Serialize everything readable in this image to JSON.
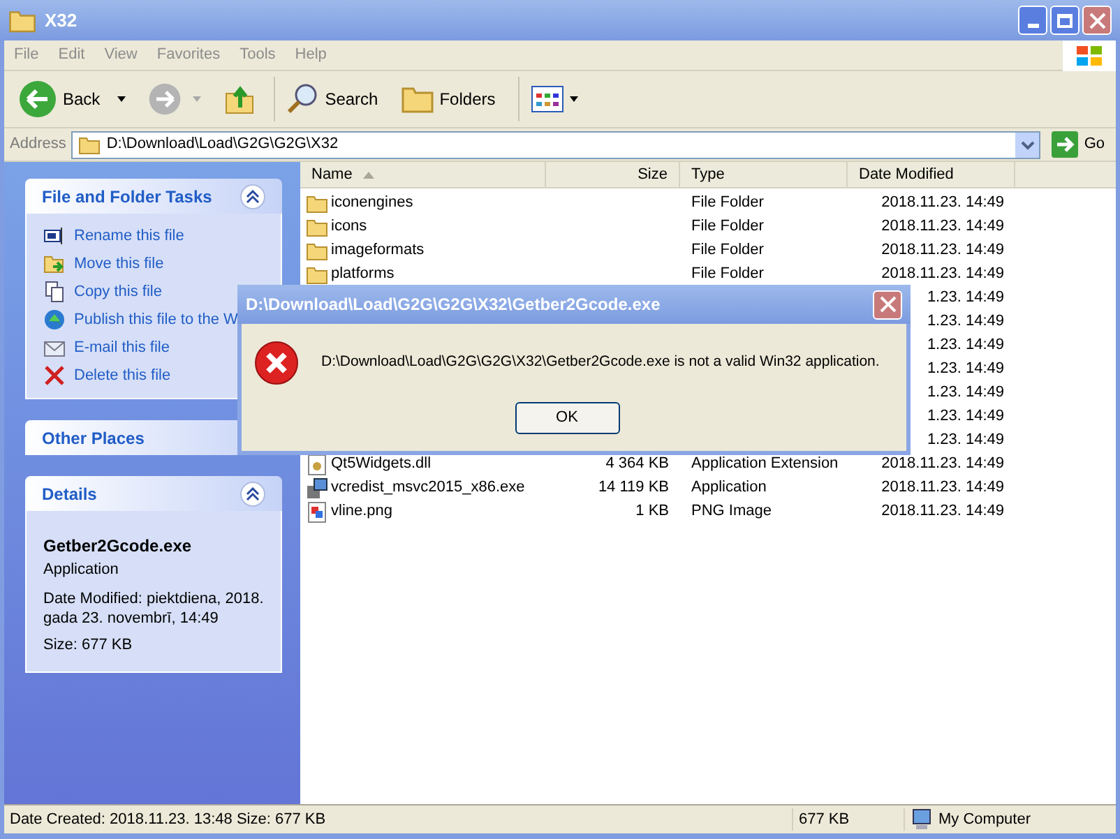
{
  "window": {
    "title": "X32"
  },
  "menu": [
    "File",
    "Edit",
    "View",
    "Favorites",
    "Tools",
    "Help"
  ],
  "toolbar": [
    {
      "kind": "back",
      "label": "Back"
    },
    {
      "kind": "forward"
    },
    {
      "kind": "up"
    },
    {
      "kind": "search",
      "label": "Search"
    },
    {
      "kind": "folders",
      "label": "Folders"
    },
    {
      "kind": "views"
    }
  ],
  "address": {
    "label": "Address",
    "value": "D:\\Download\\Load\\G2G\\G2G\\X32",
    "go": "Go"
  },
  "sidebar": {
    "panels": [
      {
        "title": "File and Folder Tasks",
        "expanded": true,
        "kind": "tasks",
        "items": [
          "Rename this file",
          "Move this file",
          "Copy this file",
          "Publish this file to the W",
          "E-mail this file",
          "Delete this file"
        ]
      },
      {
        "title": "Other Places",
        "kind": "places"
      },
      {
        "title": "Details",
        "expanded": true,
        "kind": "details",
        "name": "Getber2Gcode.exe",
        "type": "Application",
        "lines": [
          "Date Modified: piektdiena, 2018. gada 23. novembrī, 14:49",
          "Size: 677 KB"
        ]
      }
    ]
  },
  "table": {
    "columns": [
      {
        "label": "Name",
        "sorted": true
      },
      {
        "label": "Size",
        "sorted": false
      },
      {
        "label": "Type",
        "sorted": false
      },
      {
        "label": "Date Modified",
        "sorted": false
      }
    ],
    "rows": [
      {
        "kind": "folder",
        "name": "iconengines",
        "type": "File Folder",
        "date": "2018.11.23. 14:49"
      },
      {
        "kind": "folder",
        "name": "icons",
        "type": "File Folder",
        "date": "2018.11.23. 14:49"
      },
      {
        "kind": "folder",
        "name": "imageformats",
        "type": "File Folder",
        "date": "2018.11.23. 14:49"
      },
      {
        "kind": "folder",
        "name": "platforms",
        "type": "File Folder",
        "date": "2018.11.23. 14:49"
      },
      {
        "date": "1.23. 14:49"
      },
      {
        "date": "1.23. 14:49"
      },
      {
        "date": "1.23. 14:49"
      },
      {
        "date": "1.23. 14:49"
      },
      {
        "date": "1.23. 14:49"
      },
      {
        "date": "1.23. 14:49"
      },
      {
        "date": "1.23. 14:49"
      },
      {
        "kind": "dll",
        "name": "Qt5Widgets.dll",
        "size": "4 364 KB",
        "type": "Application Extension",
        "date": "2018.11.23. 14:49"
      },
      {
        "kind": "installer",
        "name": "vcredist_msvc2015_x86.exe",
        "size": "14 119 KB",
        "type": "Application",
        "date": "2018.11.23. 14:49"
      },
      {
        "kind": "image",
        "name": "vline.png",
        "size": "1 KB",
        "type": "PNG Image",
        "date": "2018.11.23. 14:49"
      }
    ]
  },
  "dialog": {
    "title": "D:\\Download\\Load\\G2G\\G2G\\X32\\Getber2Gcode.exe",
    "message": "D:\\Download\\Load\\G2G\\G2G\\X32\\Getber2Gcode.exe is not a valid Win32 application.",
    "button": "OK"
  },
  "status_bar": {
    "info": "Date Created: 2018.11.23. 13:48 Size: 677 KB",
    "size": "677 KB",
    "zone": "My Computer"
  }
}
